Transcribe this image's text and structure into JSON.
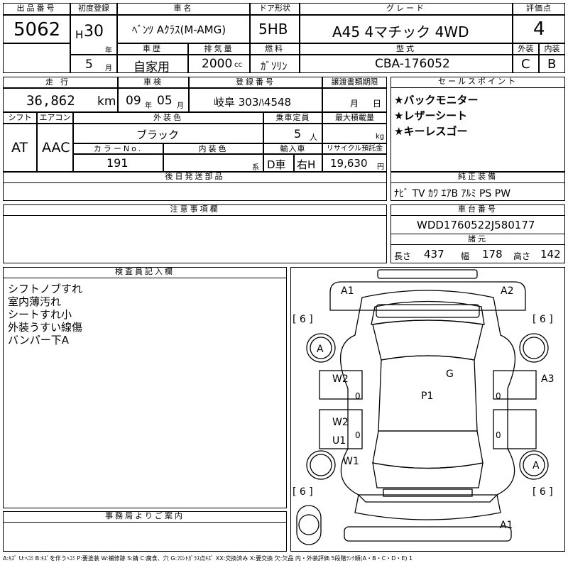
{
  "header": {
    "lot_label": "出品番号",
    "lot_no": "5062",
    "first_reg_label": "初度登録",
    "era": "H",
    "year": "30",
    "year_unit": "年",
    "month": "5",
    "month_unit": "月",
    "car_name_label": "車名",
    "car_name": "ﾍﾞﾝﾂ Aｸﾗｽ(M-AMG)",
    "door_label": "ドア形状",
    "door": "5HB",
    "grade_label": "グレード",
    "grade": "A45  4マチック  4WD",
    "score_label": "評価点",
    "score": "4",
    "history_label": "車歴",
    "history": "自家用",
    "displacement_label": "排気量",
    "displacement": "2000",
    "displacement_unit": "cc",
    "fuel_label": "燃料",
    "fuel": "ｶﾞｿﾘﾝ",
    "model_label": "型式",
    "model": "CBA-176052",
    "exterior_label": "外装",
    "exterior": "C",
    "interior_label": "内装",
    "interior": "B"
  },
  "row2": {
    "mileage_label": "走行",
    "mileage": "36,862",
    "mileage_unit": "km",
    "inspection_label": "車検",
    "insp_year": "09",
    "insp_year_unit": "年",
    "insp_month": "05",
    "insp_month_unit": "月",
    "reg_label": "登録番号",
    "reg_no": "岐阜 303ﾊ4548",
    "transfer_label": "譲渡書類期限",
    "transfer_month": "月",
    "transfer_day": "日",
    "shift_label": "シフト",
    "shift": "AT",
    "ac_label": "エアコン",
    "ac": "AAC",
    "ext_color_label": "外装色",
    "ext_color": "ブラック",
    "capacity_label": "乗車定員",
    "capacity": "5",
    "capacity_unit": "人",
    "load_label": "最大積載量",
    "load_unit": "kg",
    "color_no_label": "カラーNo.",
    "color_no": "191",
    "int_color_label": "内装色",
    "int_color_unit": "系",
    "import_label": "輸入車",
    "import": "D車",
    "steering": "右H",
    "recycle_label": "リサイクル預託金",
    "recycle": "19,630",
    "recycle_unit": "円"
  },
  "sales": {
    "label": "セールスポイント",
    "items": [
      "★バックモニター",
      "★レザーシート",
      "★キーレスゴー"
    ]
  },
  "later_parts_label": "後日発送部品",
  "equipment": {
    "label": "純正装備",
    "value": "ﾅﾋﾞ  TV  ｶﾜ  ｴｱB  ｱﾙﾐ  PS  PW"
  },
  "notes_label": "注意事項欄",
  "chassis": {
    "label": "車台番号",
    "value": "WDD1760522J580177"
  },
  "specs": {
    "label": "諸元",
    "length_label": "長さ",
    "length": "437",
    "width_label": "幅",
    "width": "178",
    "height_label": "高さ",
    "height": "142"
  },
  "inspector": {
    "label": "検査員記入欄",
    "lines": [
      "シフトノブすれ",
      "室内薄汚れ",
      "シートすれ小",
      "外装うすい線傷",
      "バンパー下A"
    ]
  },
  "office_label": "事務局よりご案内",
  "diagram": {
    "marks": [
      "A1",
      "A2",
      "A",
      "A",
      "A3",
      "W2",
      "G",
      "P1",
      "W2",
      "U1",
      "W1",
      "A1"
    ],
    "tires": [
      "[ 6 ]",
      "[ 6 ]",
      "[ 6 ]",
      "[ 6 ]"
    ],
    "zero": "0"
  },
  "legend": "A:ｷｽﾞ  U:ﾍｺﾐ  B:ｷｽﾞを伴うﾍｺﾐ  P:要塗装  W:補修跡  S:錆  C:腐食、穴  G:ﾌﾛﾝﾄｶﾞﾗｽ点ｷｽﾞ  XX:交換済み  X:要交換  欠:欠品  内・外装評価  5段階ﾗﾝｸ順(A・B・C・D・E)  1"
}
